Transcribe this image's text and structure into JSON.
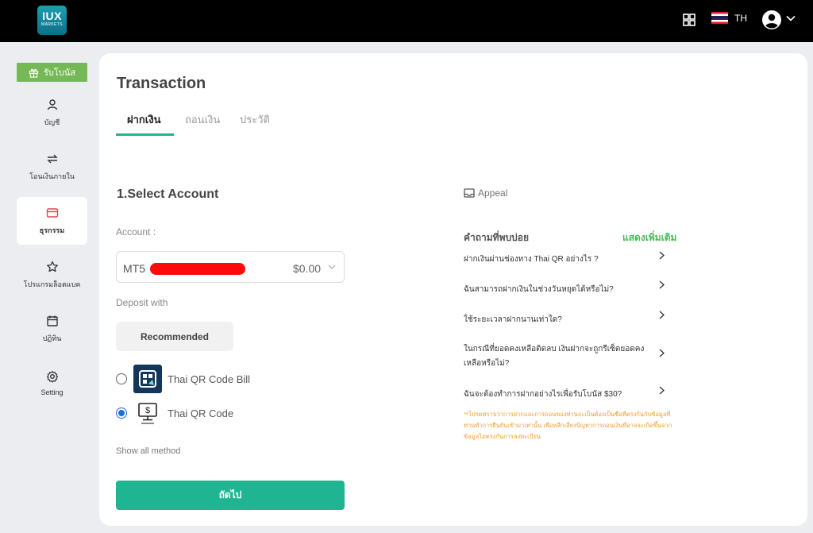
{
  "header": {
    "logo_main": "IUX",
    "logo_sub": "MARKETS",
    "language": "TH"
  },
  "sidebar": {
    "bonus_label": "รับโบนัส",
    "items": [
      {
        "label": "บัญชี",
        "icon": "user-icon",
        "active": false
      },
      {
        "label": "โอนเงินภายใน",
        "icon": "transfer-icon",
        "active": false
      },
      {
        "label": "ธุรกรรม",
        "icon": "card-icon",
        "active": true
      },
      {
        "label": "โปรแกรมล็อตแบค",
        "icon": "star-icon",
        "active": false
      },
      {
        "label": "ปฏิทิน",
        "icon": "calendar-icon",
        "active": false
      },
      {
        "label": "Setting",
        "icon": "gear-icon",
        "active": false
      }
    ]
  },
  "main": {
    "title": "Transaction",
    "tabs": [
      {
        "label": "ฝากเงิน",
        "active": true
      },
      {
        "label": "ถอนเงิน",
        "active": false
      },
      {
        "label": "ประวัติ",
        "active": false
      }
    ],
    "section_title": "1.Select Account",
    "account_label": "Account :",
    "account": {
      "type": "MT5",
      "balance": "$0.00"
    },
    "deposit_with_label": "Deposit with",
    "recommended_label": "Recommended",
    "methods": [
      {
        "name": "Thai QR Code Bill",
        "selected": false
      },
      {
        "name": "Thai QR Code",
        "selected": true
      }
    ],
    "show_all_label": "Show all method",
    "next_label": "ถัดไป"
  },
  "faq": {
    "appeal_label": "Appeal",
    "title": "คำถามที่พบบ่อย",
    "more_label": "แสดงเพิ่มเติม",
    "questions": [
      "ฝากเงินผ่านช่องทาง Thai QR อย่างไร ?",
      "ฉันสามารถฝากเงินในช่วงวันหยุดได้หรือไม่?",
      "ใช้ระยะเวลาฝากนานเท่าใด?",
      "ในกรณีที่ยอดคงเหลือติดลบ เงินฝากจะถูกรีเซ็ตยอดคงเหลือหรือไม่?",
      "ฉันจะต้องทำการฝากอย่างไรเพื่อรับโบนัส $30?"
    ],
    "note": "**โปรดทราบว่าการฝากและการถอนของท่านจะเป็นต้องเป็นชื่อที่ตรงกันกับข้อมูลที่ท่านทำการยืนยันเข้ามาเท่านั้น เพื่อหลีกเลี่ยงปัญหาการถอนเงินที่อาจจะเกิดขึ้นจากข้อมูลไม่ตรงกันการลงทะเบียน"
  },
  "colors": {
    "accent": "#1fb592",
    "bonus": "#75b957",
    "link": "#4cb95a",
    "warning": "#f29a2e",
    "redaction": "#ff0a0a"
  }
}
